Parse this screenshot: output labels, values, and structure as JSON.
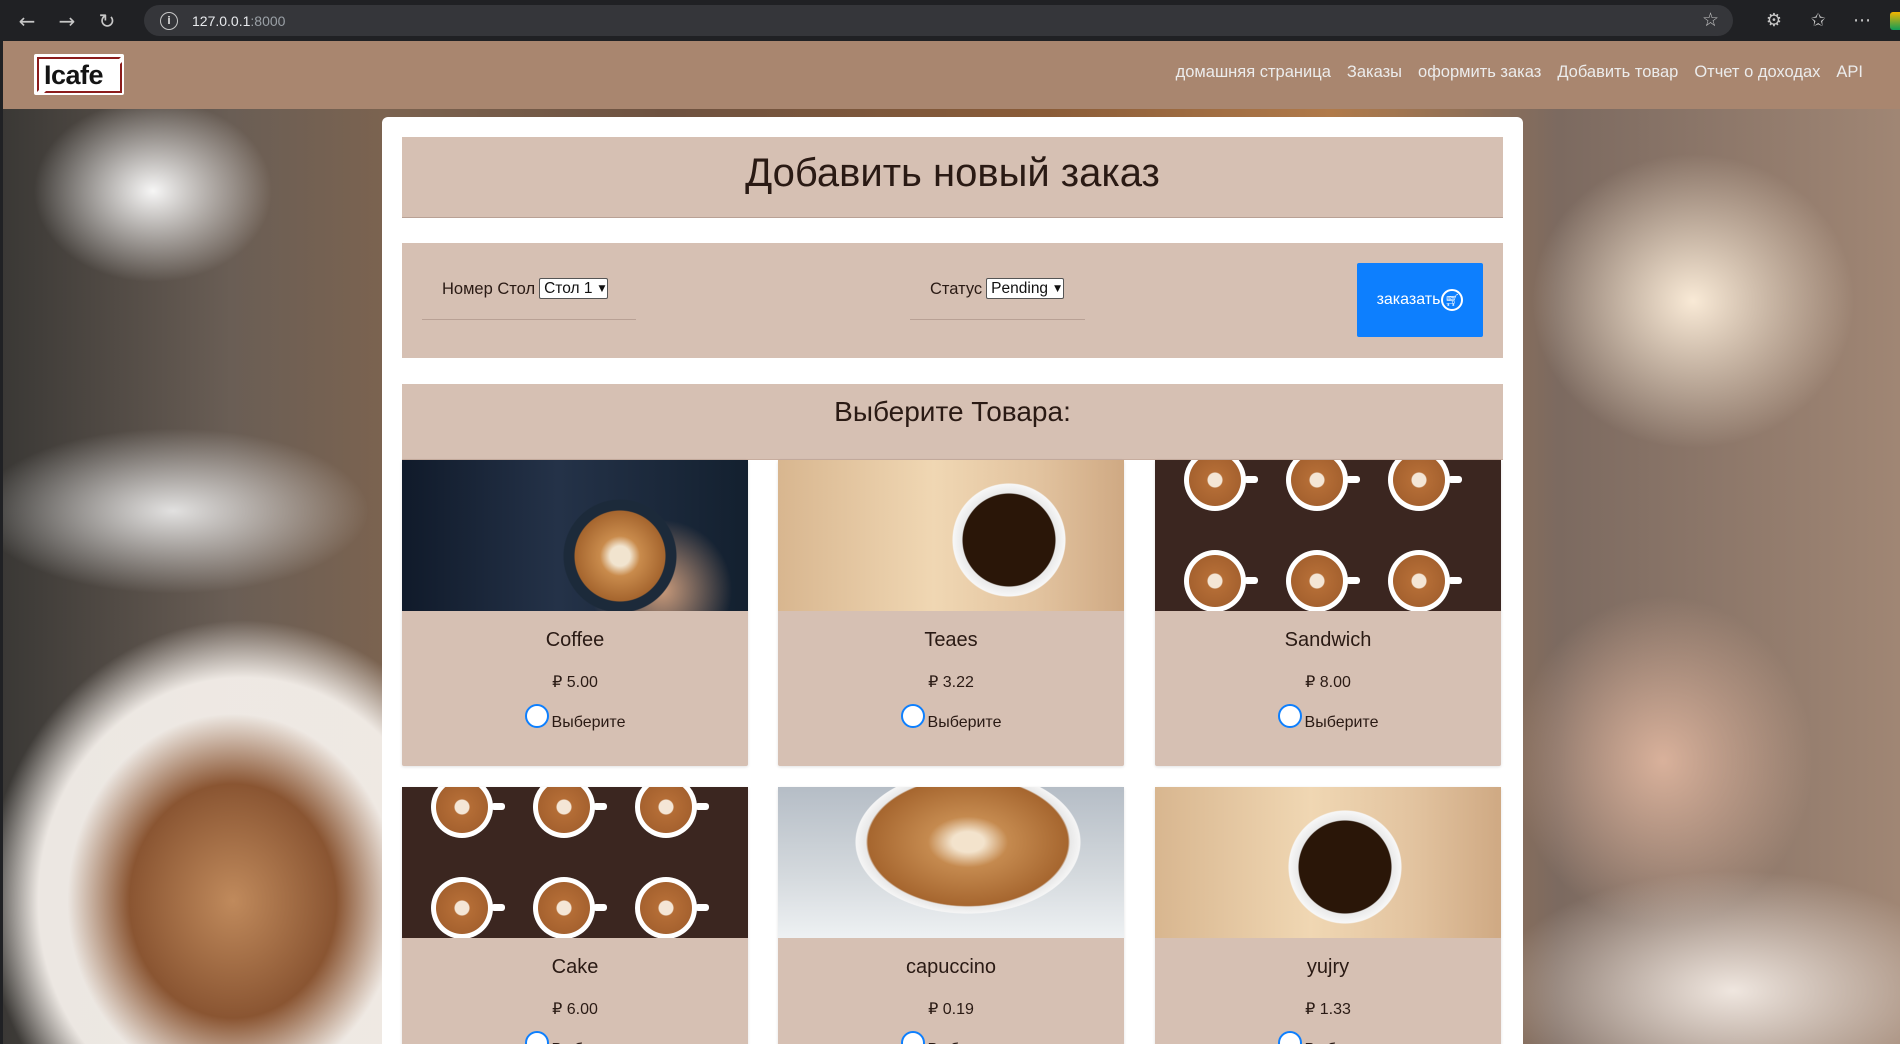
{
  "browser": {
    "url_host": "127.0.0.1",
    "url_port": ":8000"
  },
  "site": {
    "logo_text": "Icafe",
    "nav": [
      {
        "label": "домашняя страница"
      },
      {
        "label": "Заказы"
      },
      {
        "label": "оформить заказ"
      },
      {
        "label": "Добавить товар"
      },
      {
        "label": "Отчет о доходах"
      },
      {
        "label": "API"
      }
    ]
  },
  "form": {
    "title": "Добавить новый заказ",
    "table_label": "Номер Стол",
    "table_value": "Стол 1",
    "status_label": "Статус",
    "status_value": "Pending",
    "submit_label": "заказать",
    "accent_color": "#0d7ffe"
  },
  "products": {
    "heading": "Выберите Товара:",
    "choose_label": "Выберите",
    "items": [
      {
        "name": "Coffee",
        "price": "₽ 5.00"
      },
      {
        "name": "Teaes",
        "price": "₽ 3.22"
      },
      {
        "name": "Sandwich",
        "price": "₽ 8.00"
      },
      {
        "name": "Cake",
        "price": "₽ 6.00"
      },
      {
        "name": "capuccino",
        "price": "₽ 0.19"
      },
      {
        "name": "yujry",
        "price": "₽ 1.33"
      }
    ]
  }
}
